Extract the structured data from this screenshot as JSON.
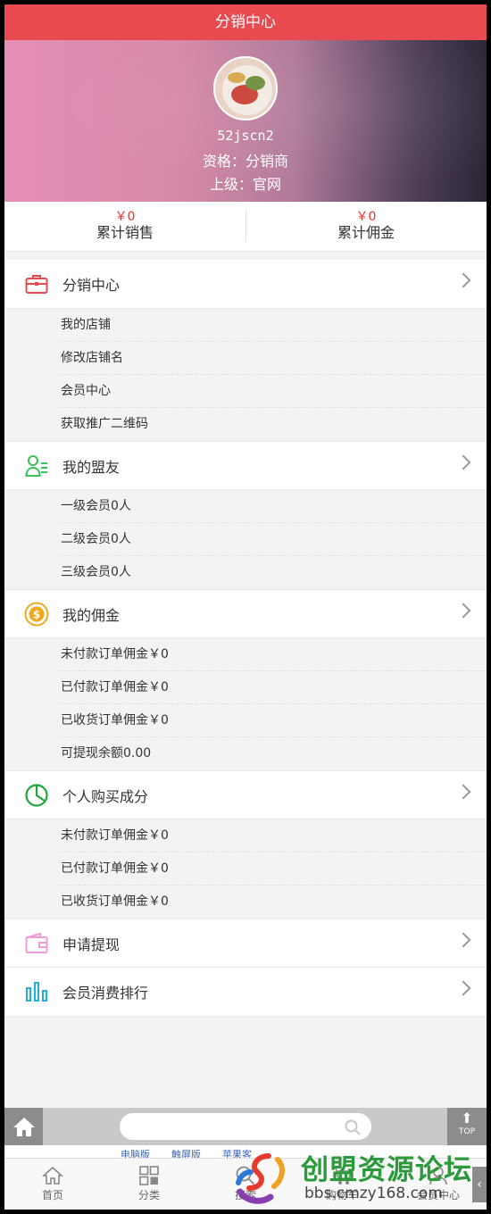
{
  "header": {
    "title": "分销中心"
  },
  "profile": {
    "username": "52jscn2",
    "qualification": "资格：分销商",
    "superior": "上级：官网"
  },
  "stats": [
    {
      "amount": "￥0",
      "label": "累计销售"
    },
    {
      "amount": "￥0",
      "label": "累计佣金"
    }
  ],
  "sections": {
    "distribution": {
      "title": "分销中心",
      "icon": "briefcase-icon",
      "items": [
        "我的店铺",
        "修改店铺名",
        "会员中心",
        "获取推广二维码"
      ]
    },
    "allies": {
      "title": "我的盟友",
      "icon": "users-list-icon",
      "items": [
        "一级会员0人",
        "二级会员0人",
        "三级会员0人"
      ]
    },
    "commission": {
      "title": "我的佣金",
      "icon": "dollar-coin-icon",
      "items": [
        "未付款订单佣金￥0",
        "已付款订单佣金￥0",
        "已收货订单佣金￥0",
        "可提现余额0.00"
      ]
    },
    "personal": {
      "title": "个人购买成分",
      "icon": "pie-chart-icon",
      "items": [
        "未付款订单佣金￥0",
        "已付款订单佣金￥0",
        "已收货订单佣金￥0"
      ]
    },
    "withdraw": {
      "title": "申请提现",
      "icon": "wallet-icon"
    },
    "ranking": {
      "title": "会员消费排行",
      "icon": "bar-chart-icon"
    }
  },
  "footer": {
    "top_label": "TOP",
    "links": [
      "电脑版",
      "触屏版",
      "苹果客"
    ],
    "tabs": [
      {
        "label": "首页",
        "icon": "home-icon"
      },
      {
        "label": "分类",
        "icon": "grid-icon"
      },
      {
        "label": "搜索",
        "icon": "search-icon"
      },
      {
        "label": "购物车",
        "icon": "cart-icon"
      },
      {
        "label": "会员中心",
        "icon": "user-icon"
      }
    ]
  },
  "watermark": {
    "title": "创盟资源论坛",
    "url": "bbs.cmzy168.com"
  },
  "colors": {
    "accent": "#e84b4f",
    "price": "#ee3333",
    "link": "#3a66b8"
  }
}
